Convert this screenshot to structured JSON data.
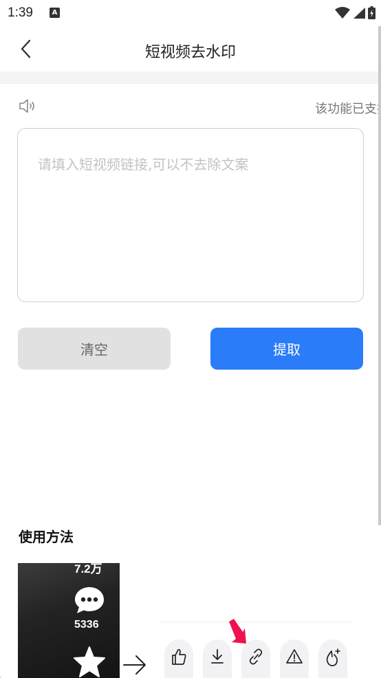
{
  "status_bar": {
    "time": "1:39",
    "notification_icon": "A"
  },
  "header": {
    "title": "短视频去水印",
    "back_icon": "chevron-left-icon"
  },
  "notice": {
    "icon": "speaker-icon",
    "text": "该功能已支持抖音、快手等平台"
  },
  "input": {
    "value": "",
    "placeholder": "请填入短视频链接,可以不去除文案"
  },
  "buttons": {
    "clear_label": "清空",
    "extract_label": "提取"
  },
  "usage": {
    "title": "使用方法",
    "demo": {
      "top_count": "7.2万",
      "comment_count": "5336"
    },
    "share_icons": [
      "like-icon",
      "download-icon",
      "link-icon",
      "report-icon",
      "effect-icon"
    ]
  },
  "colors": {
    "accent": "#2a7cf8",
    "clear_bg": "#e1e1e1",
    "highlight_arrow": "#f0124f"
  }
}
